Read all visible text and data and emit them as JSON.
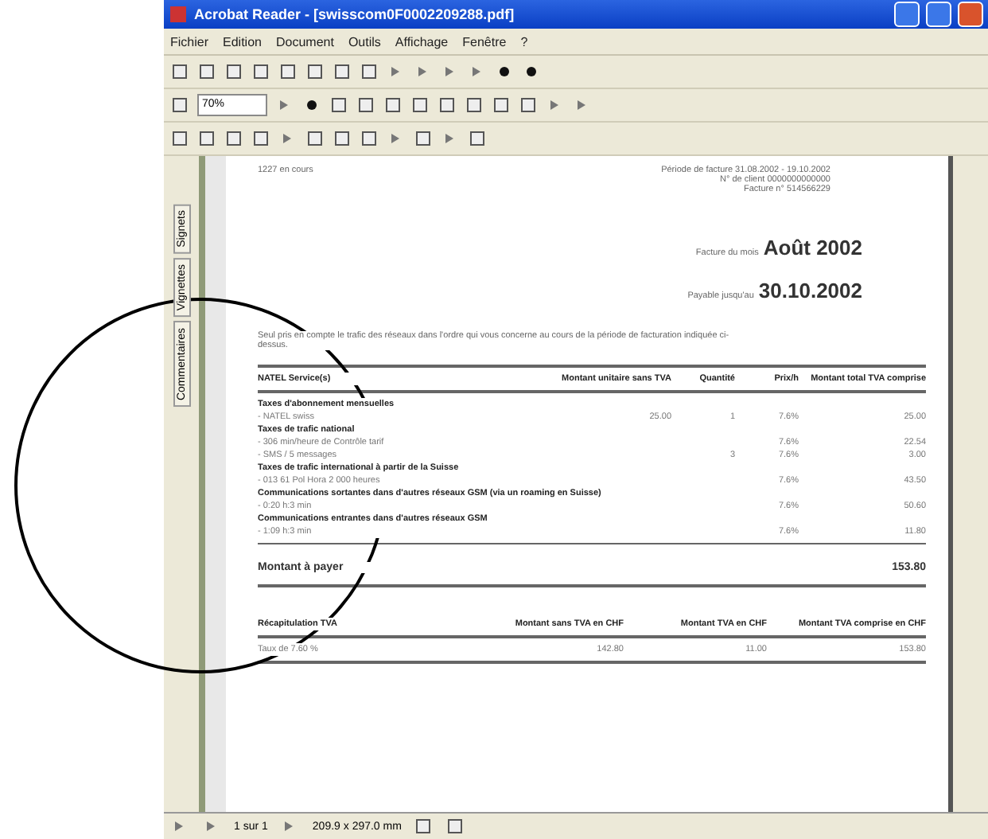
{
  "window": {
    "title": "Acrobat Reader - [swisscom0F0002209288.pdf]"
  },
  "menu": [
    "Fichier",
    "Edition",
    "Document",
    "Outils",
    "Affichage",
    "Fenêtre",
    "?"
  ],
  "zoom": {
    "value": "70%"
  },
  "nav_tabs": [
    {
      "label": "Signets",
      "selected": false
    },
    {
      "label": "Vignettes",
      "selected": false
    },
    {
      "label": "Commentaires",
      "selected": false
    }
  ],
  "document": {
    "sender": "1227 en cours",
    "header_lines": [
      "Période de facture 31.08.2002 - 19.10.2002",
      "N° de client 0000000000000",
      "Facture n° 514566229"
    ],
    "month_label": "Facture du mois",
    "month": "Août 2002",
    "due_label": "Payable jusqu'au",
    "due": "30.10.2002",
    "intro": "Seul pris en compte le trafic des réseaux dans l'ordre qui vous concerne au cours de la période de facturation indiquée ci-dessus.",
    "columns": [
      "NATEL Service(s)",
      "Montant unitaire sans TVA",
      "Quantité",
      "Prix/h",
      "Montant total TVA comprise"
    ],
    "sections": [
      {
        "title": "Taxes d'abonnement mensuelles",
        "rows": [
          [
            "- NATEL swiss",
            "25.00",
            "1",
            "7.6%",
            "25.00"
          ]
        ]
      },
      {
        "title": "Taxes de trafic national",
        "rows": [
          [
            "- 306 min/heure de Contrôle tarif",
            "",
            "",
            "7.6%",
            "22.54"
          ],
          [
            "- SMS / 5 messages",
            "",
            "3",
            "7.6%",
            "3.00"
          ]
        ]
      },
      {
        "title": "Taxes de trafic international à partir de la Suisse",
        "rows": [
          [
            "- 013 61 Pol Hora 2 000 heures",
            "",
            "",
            "7.6%",
            "43.50"
          ]
        ]
      },
      {
        "title": "Communications sortantes dans d'autres réseaux GSM (via un roaming en Suisse)",
        "rows": [
          [
            "- 0:20 h:3 min",
            "",
            "",
            "7.6%",
            "50.60"
          ]
        ]
      },
      {
        "title": "Communications entrantes dans d'autres réseaux GSM",
        "rows": [
          [
            "- 1:09 h:3 min",
            "",
            "",
            "7.6%",
            "11.80"
          ]
        ]
      }
    ],
    "total_label": "Montant à payer",
    "total": "153.80",
    "vat_columns": [
      "Récapitulation TVA",
      "Montant sans TVA en CHF",
      "Montant TVA en CHF",
      "Montant TVA comprise en CHF"
    ],
    "vat_rows": [
      [
        "Taux de 7.60 %",
        "142.80",
        "11.00",
        "153.80"
      ]
    ]
  },
  "status_bar": {
    "page": "1 sur 1",
    "size": "209.9 x 297.0 mm"
  }
}
